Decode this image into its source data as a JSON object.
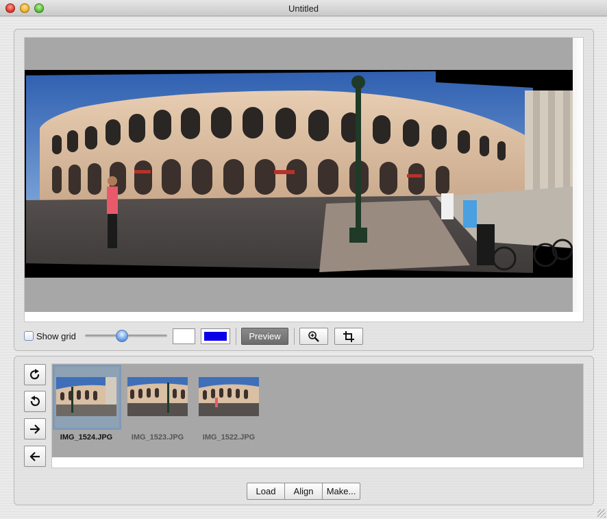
{
  "window": {
    "title": "Untitled"
  },
  "toolbar": {
    "show_grid_label": "Show grid",
    "show_grid_checked": false,
    "slider_fraction": 0.45,
    "color_white": "#ffffff",
    "color_blue": "#0a00e8",
    "preview_label": "Preview",
    "zoom_icon": "zoom-in-icon",
    "crop_icon": "crop-icon"
  },
  "side_buttons": [
    "rotate-clockwise-icon",
    "rotate-counterclockwise-icon",
    "arrow-right-icon",
    "arrow-left-icon"
  ],
  "thumbnails": [
    {
      "label": "IMG_1524.JPG",
      "selected": true
    },
    {
      "label": "IMG_1523.JPG",
      "selected": false
    },
    {
      "label": "IMG_1522.JPG",
      "selected": false
    }
  ],
  "actions": {
    "load": "Load",
    "align": "Align",
    "make": "Make..."
  },
  "colors": {
    "sky": "#3f6fb8",
    "arena": "#d9bfa3",
    "ground": "#4a4645"
  }
}
